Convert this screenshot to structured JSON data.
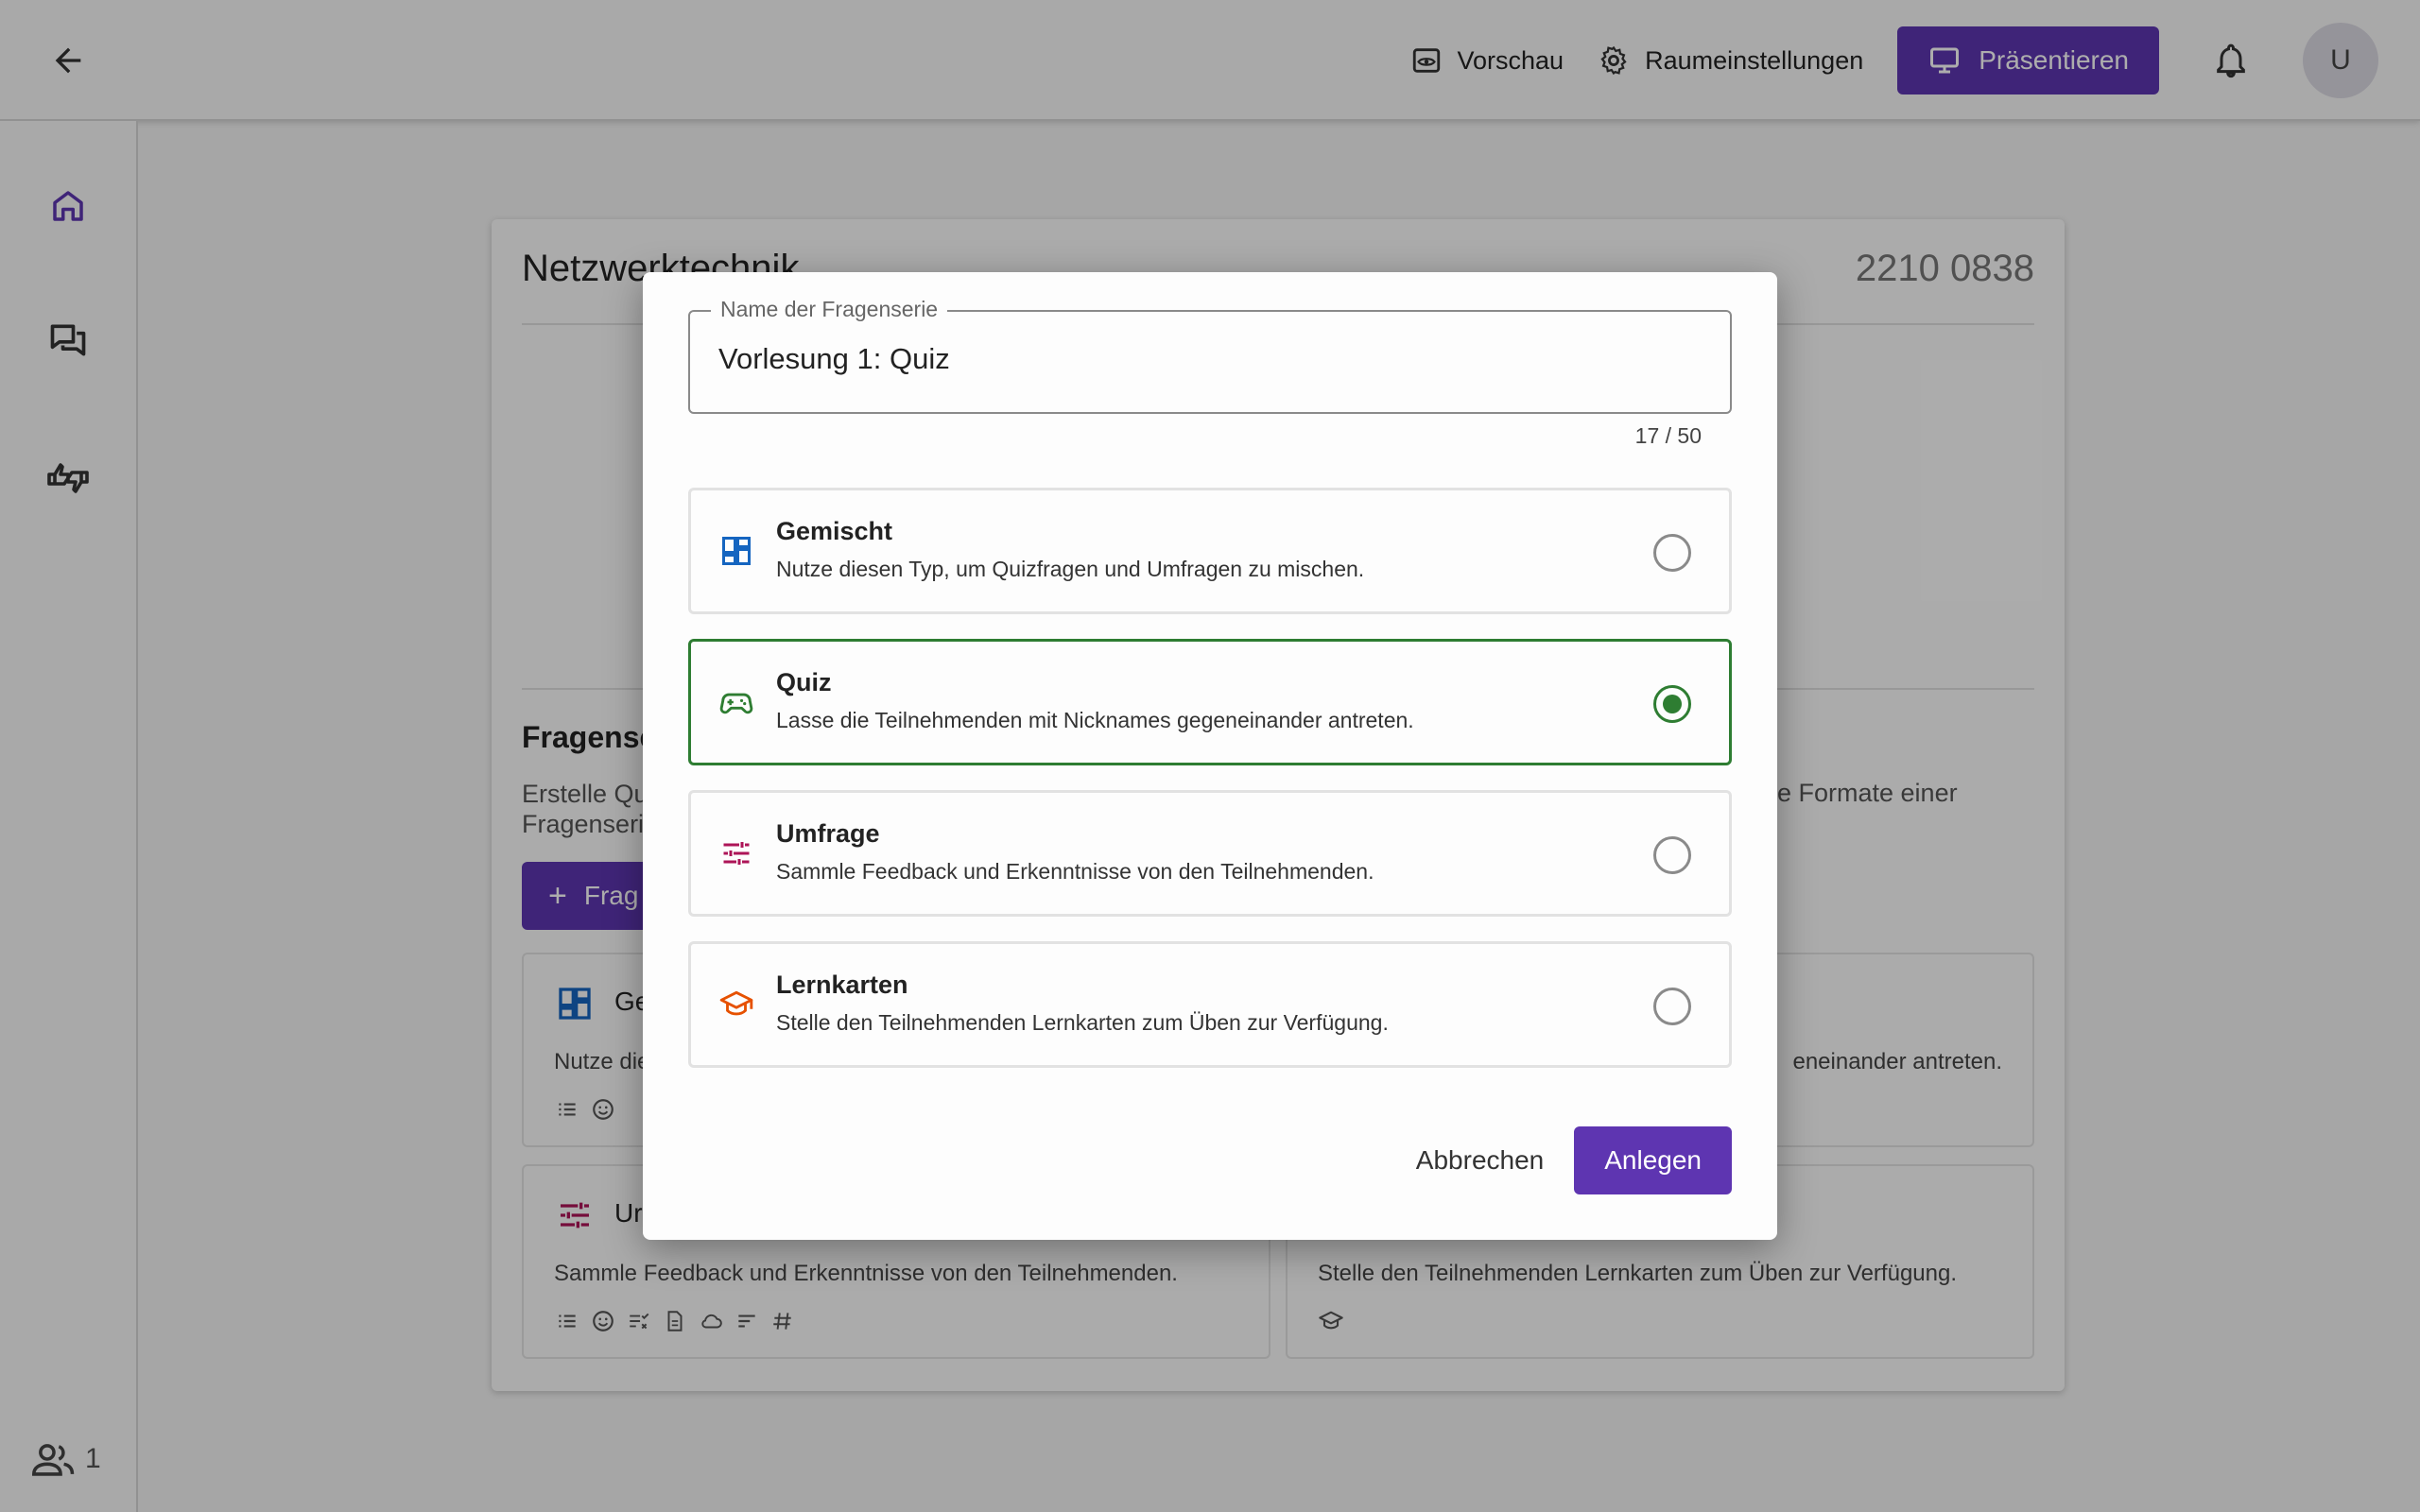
{
  "topbar": {
    "preview_label": "Vorschau",
    "room_settings_label": "Raumeinstellungen",
    "present_label": "Präsentieren",
    "avatar_initial": "U"
  },
  "sidebar": {
    "participants_count": "1"
  },
  "room": {
    "title": "Netzwerktechnik",
    "code": "2210 0838",
    "series_heading": "Fragense",
    "series_desc_left": "Erstelle Qu Fragenseri",
    "series_desc_right": "e Formate einer",
    "add_series_label": "Frag",
    "cards": [
      {
        "title": "Ge",
        "desc": "Nutze die"
      },
      {
        "title": "",
        "desc": "eneinander antreten."
      },
      {
        "title": "Ur",
        "desc": "Sammle Feedback und Erkenntnisse von den Teilnehmenden."
      },
      {
        "title": "",
        "desc": "Stelle den Teilnehmenden Lernkarten zum Üben zur Verfügung."
      }
    ]
  },
  "dialog": {
    "field_label": "Name der Fragenserie",
    "field_value": "Vorlesung 1: Quiz",
    "counter": "17 / 50",
    "options": [
      {
        "title": "Gemischt",
        "desc": "Nutze diesen Typ, um Quizfragen und Umfragen zu mischen.",
        "icon": "dashboard-icon",
        "color": "#1565c0",
        "selected": false
      },
      {
        "title": "Quiz",
        "desc": "Lasse die Teilnehmenden mit Nicknames gegeneinander antreten.",
        "icon": "gamepad-icon",
        "color": "#2e7d32",
        "selected": true
      },
      {
        "title": "Umfrage",
        "desc": "Sammle Feedback und Erkenntnisse von den Teilnehmenden.",
        "icon": "tune-icon",
        "color": "#ad1457",
        "selected": false
      },
      {
        "title": "Lernkarten",
        "desc": "Stelle den Teilnehmenden Lernkarten zum Üben zur Verfügung.",
        "icon": "school-icon",
        "color": "#e65100",
        "selected": false
      }
    ],
    "cancel_label": "Abbrechen",
    "create_label": "Anlegen"
  },
  "colors": {
    "primary": "#5e35b1",
    "selected_border": "#2e7d32"
  }
}
